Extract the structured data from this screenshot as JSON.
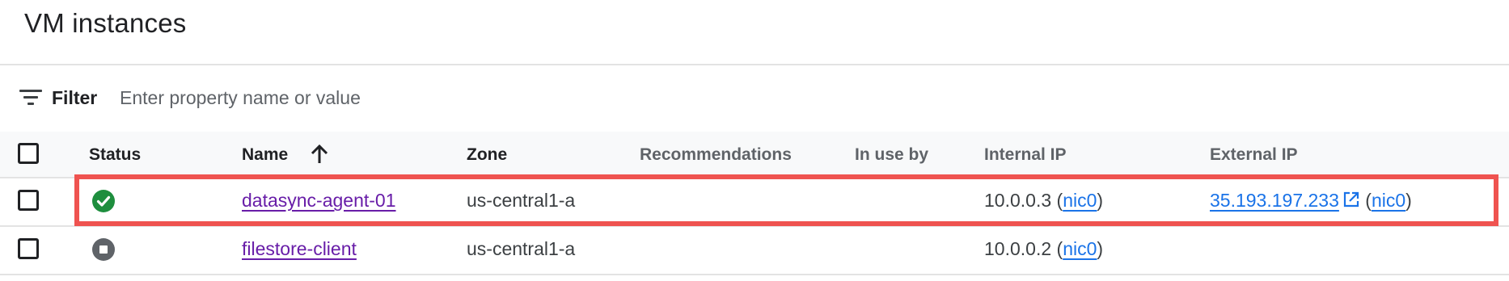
{
  "page": {
    "title": "VM instances"
  },
  "filter": {
    "label": "Filter",
    "placeholder": "Enter property name or value"
  },
  "table": {
    "columns": {
      "status": "Status",
      "name": "Name",
      "zone": "Zone",
      "recommendations": "Recommendations",
      "in_use_by": "In use by",
      "internal_ip": "Internal IP",
      "external_ip": "External IP"
    },
    "rows": [
      {
        "status": "running",
        "name": "datasync-agent-01",
        "zone": "us-central1-a",
        "recommendations": "",
        "in_use_by": "",
        "internal_ip": "10.0.0.3",
        "internal_nic": "nic0",
        "external_ip": "35.193.197.233",
        "external_nic": "nic0",
        "highlighted": true
      },
      {
        "status": "stopped",
        "name": "filestore-client",
        "zone": "us-central1-a",
        "recommendations": "",
        "in_use_by": "",
        "internal_ip": "10.0.0.2",
        "internal_nic": "nic0",
        "external_ip": "",
        "external_nic": ""
      }
    ]
  },
  "colors": {
    "highlight_border": "#ef5350",
    "status_running": "#1e8e3e",
    "status_stopped": "#5f6368",
    "visited_link": "#681da8",
    "link": "#1a73e8"
  },
  "icons": {
    "filter": "filter-lines-icon",
    "sort": "arrow-up-icon",
    "running": "check-circle-icon",
    "stopped": "stop-circle-icon",
    "external_link": "open-in-new-icon"
  }
}
